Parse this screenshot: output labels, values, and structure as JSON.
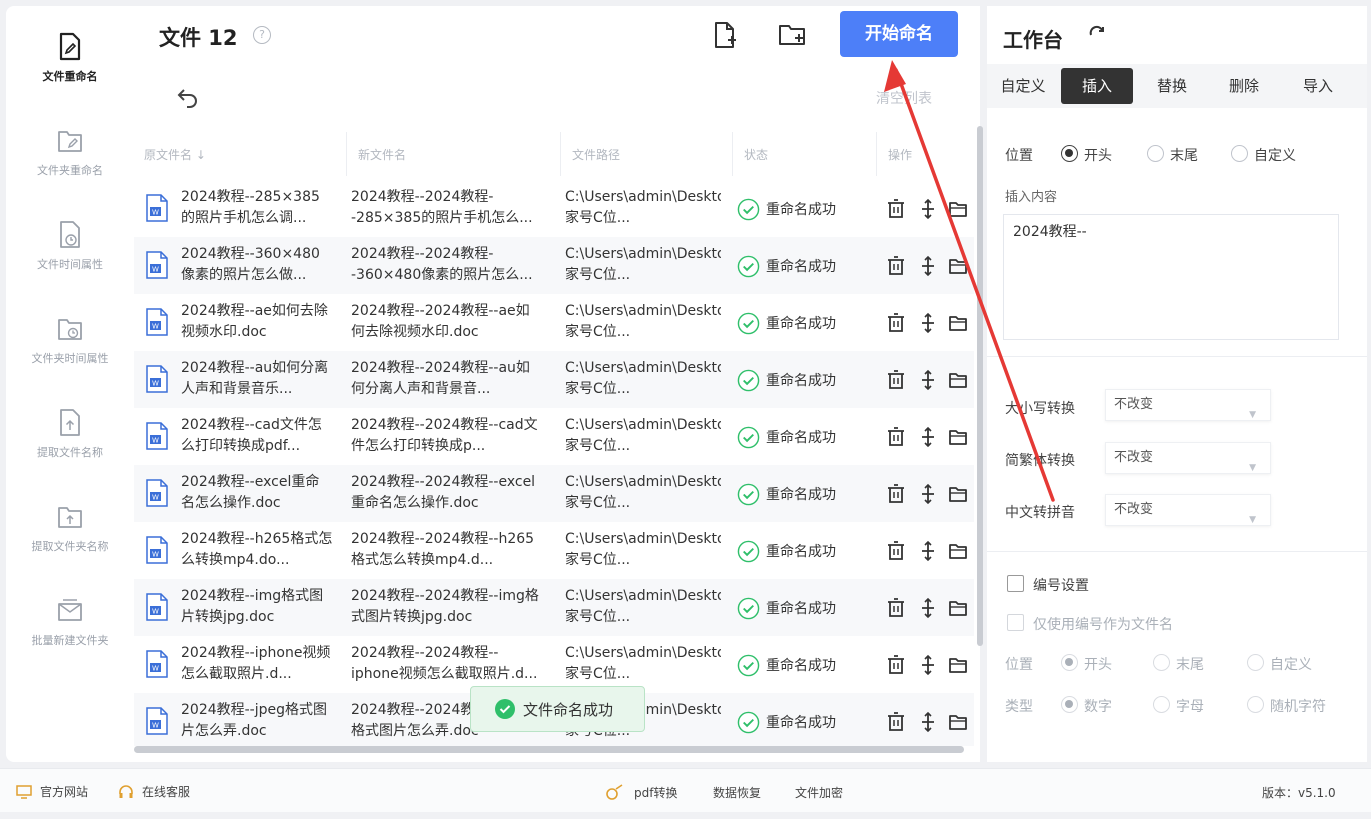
{
  "sidebar": {
    "items": [
      {
        "label": "文件重命名",
        "icon": "file-edit-icon",
        "active": true
      },
      {
        "label": "文件夹重命名",
        "icon": "folder-edit-icon"
      },
      {
        "label": "文件时间属性",
        "icon": "file-clock-icon"
      },
      {
        "label": "文件夹时间属性",
        "icon": "folder-clock-icon"
      },
      {
        "label": "提取文件名称",
        "icon": "file-export-icon"
      },
      {
        "label": "提取文件夹名称",
        "icon": "folder-export-icon"
      },
      {
        "label": "批量新建文件夹",
        "icon": "folder-add-icon"
      }
    ]
  },
  "main": {
    "title": "文件 12",
    "start_button": "开始命名",
    "clear_list": "清空列表",
    "columns": [
      "原文件名 ↓",
      "新文件名",
      "文件路径",
      "状态",
      "操作"
    ],
    "rows": [
      {
        "orig": "2024教程--285×385的照片手机怎么调...",
        "new": "2024教程--2024教程--285×385的照片手机怎么...",
        "path": "C:\\Users\\admin\\Desktop\\百家号C位...",
        "status": "重命名成功"
      },
      {
        "orig": "2024教程--360×480像素的照片怎么做...",
        "new": "2024教程--2024教程--360×480像素的照片怎么...",
        "path": "C:\\Users\\admin\\Desktop\\百家号C位...",
        "status": "重命名成功"
      },
      {
        "orig": "2024教程--ae如何去除视频水印.doc",
        "new": "2024教程--2024教程--ae如何去除视频水印.doc",
        "path": "C:\\Users\\admin\\Desktop\\百家号C位...",
        "status": "重命名成功"
      },
      {
        "orig": "2024教程--au如何分离人声和背景音乐...",
        "new": "2024教程--2024教程--au如何分离人声和背景音...",
        "path": "C:\\Users\\admin\\Desktop\\百家号C位...",
        "status": "重命名成功"
      },
      {
        "orig": "2024教程--cad文件怎么打印转换成pdf...",
        "new": "2024教程--2024教程--cad文件怎么打印转换成p...",
        "path": "C:\\Users\\admin\\Desktop\\百家号C位...",
        "status": "重命名成功"
      },
      {
        "orig": "2024教程--excel重命名怎么操作.doc",
        "new": "2024教程--2024教程--excel重命名怎么操作.doc",
        "path": "C:\\Users\\admin\\Desktop\\百家号C位...",
        "status": "重命名成功"
      },
      {
        "orig": "2024教程--h265格式怎么转换mp4.do...",
        "new": "2024教程--2024教程--h265格式怎么转换mp4.d...",
        "path": "C:\\Users\\admin\\Desktop\\百家号C位...",
        "status": "重命名成功"
      },
      {
        "orig": "2024教程--img格式图片转换jpg.doc",
        "new": "2024教程--2024教程--img格式图片转换jpg.doc",
        "path": "C:\\Users\\admin\\Desktop\\百家号C位...",
        "status": "重命名成功"
      },
      {
        "orig": "2024教程--iphone视频怎么截取照片.d...",
        "new": "2024教程--2024教程--iphone视频怎么截取照片.d...",
        "path": "C:\\Users\\admin\\Desktop\\百家号C位...",
        "status": "重命名成功"
      },
      {
        "orig": "2024教程--jpeg格式图片怎么弄.doc",
        "new": "2024教程--2024教程--jpeg格式图片怎么弄.doc",
        "path": "C:\\Users\\admin\\Desktop\\百家号C位...",
        "status": "重命名成功"
      }
    ],
    "toast": "文件命名成功"
  },
  "panel": {
    "title": "工作台",
    "tabs": [
      "自定义",
      "插入",
      "替换",
      "删除",
      "导入"
    ],
    "active_tab": "插入",
    "position_label": "位置",
    "position_options": [
      "开头",
      "末尾",
      "自定义"
    ],
    "insert_label": "插入内容",
    "insert_value": "2024教程--",
    "case_label": "大小写转换",
    "case_value": "不改变",
    "trad_label": "简繁体转换",
    "trad_value": "不改变",
    "pinyin_label": "中文转拼音",
    "pinyin_value": "不改变",
    "numbering_label": "编号设置",
    "numbering_only_label": "仅使用编号作为文件名",
    "num_position_label": "位置",
    "num_position_options": [
      "开头",
      "末尾",
      "自定义"
    ],
    "num_type_label": "类型",
    "num_type_options": [
      "数字",
      "字母",
      "随机字符"
    ]
  },
  "statusbar": {
    "website": "官方网站",
    "support": "在线客服",
    "pdf": "pdf转换",
    "recovery": "数据恢复",
    "encrypt": "文件加密",
    "version": "版本：v5.1.0"
  },
  "colors": {
    "accent": "#4d7ff8",
    "success": "#2fbf6a",
    "arrow": "#e53935",
    "word": "#3b6fd8"
  }
}
